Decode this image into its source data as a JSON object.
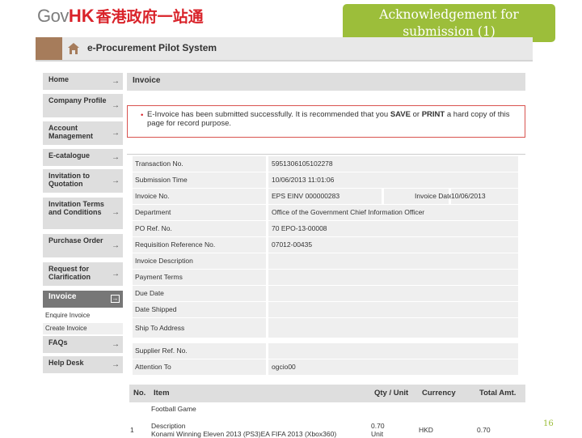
{
  "logo": {
    "gov": "Gov",
    "hk": "HK",
    "zh": "香港政府一站通"
  },
  "slide_title": "Acknowledgement for submission (1)",
  "system_title": "e-Procurement Pilot System",
  "sidebar": {
    "items": [
      {
        "label": "Home",
        "arrow": "→"
      },
      {
        "label": "Company Profile",
        "arrow": "→"
      },
      {
        "label": "Account Management",
        "arrow": "→"
      },
      {
        "label": "E-catalogue",
        "arrow": "→"
      },
      {
        "label": "Invitation to Quotation",
        "arrow": "→"
      },
      {
        "label": "Invitation Terms and Conditions",
        "arrow": "→"
      },
      {
        "label": "Purchase Order",
        "arrow": "→"
      },
      {
        "label": "Request for Clarification",
        "arrow": "→"
      },
      {
        "label": "Invoice",
        "arrow": "→"
      },
      {
        "label": "FAQs",
        "arrow": "→"
      },
      {
        "label": "Help Desk",
        "arrow": "→"
      }
    ],
    "sub": [
      {
        "label": "Enquire Invoice"
      },
      {
        "label": "Create Invoice"
      }
    ]
  },
  "main": {
    "heading": "Invoice",
    "alert": {
      "bullet": "•",
      "pre": "E-Invoice has been submitted successfully. It is recommended that you ",
      "save": "SAVE",
      "mid": " or ",
      "print": "PRINT",
      "post": " a hard copy of this page for record purpose."
    },
    "details": {
      "transaction_no": {
        "label": "Transaction No.",
        "value": "5951306105102278"
      },
      "submission_time": {
        "label": "Submission Time",
        "value": "10/06/2013 11:01:06"
      },
      "invoice_no": {
        "label": "Invoice No.",
        "value": "EPS EINV 000000283"
      },
      "invoice_date": {
        "label": "Invoice Date",
        "value": "10/06/2013"
      },
      "department": {
        "label": "Department",
        "value": "Office of the Government Chief Information Officer"
      },
      "po_ref": {
        "label": "PO Ref. No.",
        "value": "70 EPO-13-00008"
      },
      "requisition_ref": {
        "label": "Requisition Reference No.",
        "value": "07012-00435"
      },
      "invoice_description": {
        "label": "Invoice Description",
        "value": ""
      },
      "payment_terms": {
        "label": "Payment Terms",
        "value": ""
      },
      "due_date": {
        "label": "Due Date",
        "value": ""
      },
      "date_shipped": {
        "label": "Date Shipped",
        "value": ""
      },
      "ship_to": {
        "label": "Ship To Address",
        "value": ""
      },
      "supplier_ref": {
        "label": "Supplier Ref. No.",
        "value": ""
      },
      "attention_to": {
        "label": "Attention To",
        "value": "ogcio00"
      }
    },
    "items_table": {
      "headers": {
        "no": "No.",
        "item": "Item",
        "qty": "Qty / Unit",
        "currency": "Currency",
        "total": "Total Amt."
      },
      "rows": [
        {
          "no": "1",
          "item_name": "Football Game",
          "desc_label": "Description",
          "desc": "Konami Winning Eleven 2013 (PS3)EA FIFA 2013 (Xbox360)",
          "qty": "0.70",
          "unit": "Unit",
          "currency": "HKD",
          "total": "0.70"
        }
      ]
    }
  },
  "page_number": "16",
  "colors": {
    "green": "#9cbe3a",
    "red": "#d9232a",
    "brown": "#a67c5b",
    "grey_bar": "#dedede"
  }
}
